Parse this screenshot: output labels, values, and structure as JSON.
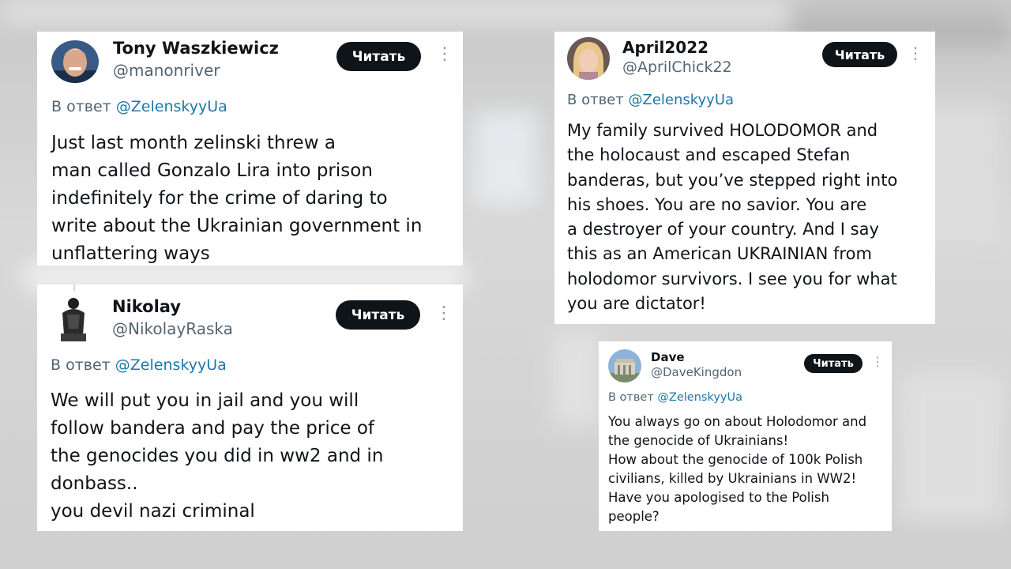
{
  "reply_prefix": "В ответ",
  "follow_label": "Читать",
  "tweets": [
    {
      "name": "Tony Waszkiewicz",
      "handle": "@manonriver",
      "mention": "@ZelenskyyUa",
      "lines": [
        "Just last month zelinski threw a",
        "man called Gonzalo Lira into prison",
        "indefinitely for the crime of daring to",
        "write about the Ukrainian government in",
        "unflattering ways"
      ]
    },
    {
      "name": "Nikolay",
      "handle": "@NikolayRaska",
      "mention": "@ZelenskyyUa",
      "lines": [
        "We will put you in jail and you will",
        "follow bandera and pay the price of",
        "the genocides you did in ww2 and in",
        "donbass..",
        "you devil nazi criminal"
      ]
    },
    {
      "name": "April2022",
      "handle": "@AprilChick22",
      "mention": "@ZelenskyyUa",
      "lines": [
        "My family survived HOLODOMOR and",
        "the holocaust and escaped Stefan",
        "banderas, but you’ve stepped right into",
        "his shoes. You are no savior. You are",
        "a destroyer of your country. And I say",
        "this as an American UKRAINIAN from",
        "holodomor survivors. I see you for what",
        "you are dictator!"
      ]
    },
    {
      "name": "Dave",
      "handle": "@DaveKingdon",
      "mention": "@ZelenskyyUa",
      "lines": [
        "You always go on about Holodomor and",
        "the genocide of Ukrainians!",
        "How about the genocide of 100k Polish",
        "civilians, killed by Ukrainians in WW2!",
        "Have you apologised to the Polish",
        "people?"
      ]
    }
  ]
}
